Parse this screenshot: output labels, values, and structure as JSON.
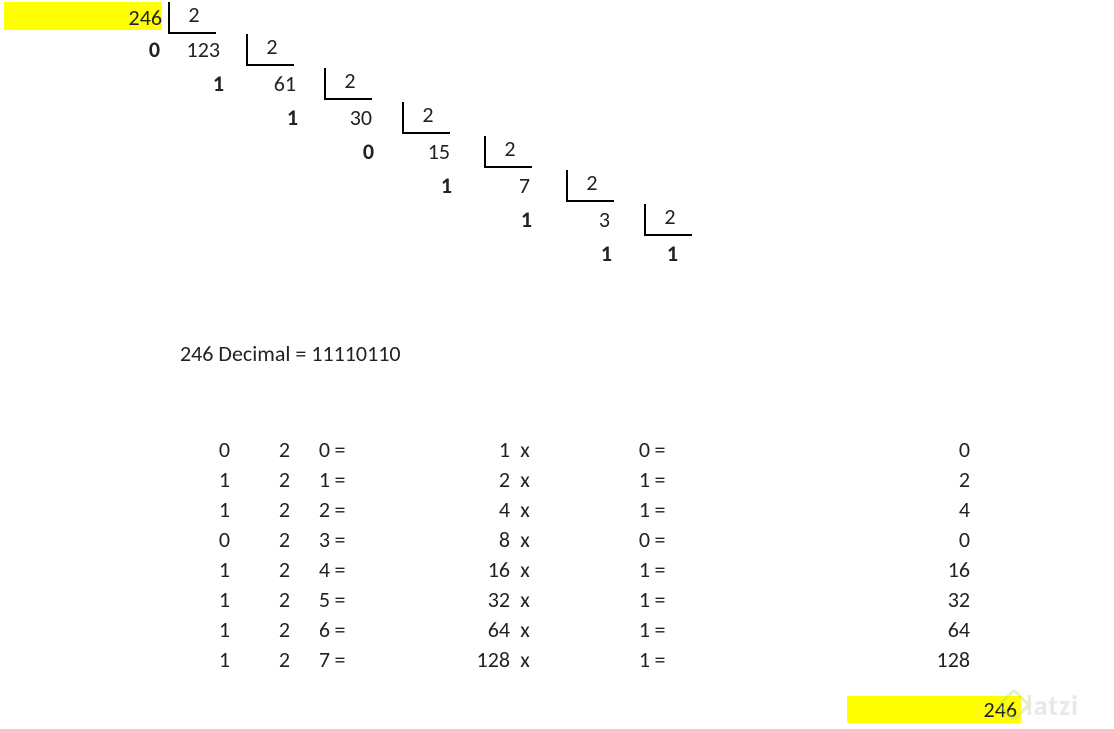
{
  "highlight_color": "#ffff00",
  "division": {
    "start_highlighted": true,
    "dividend": 246,
    "base": 2,
    "steps": [
      {
        "dividend": 246,
        "divisor": 2,
        "remainder": 0,
        "next_quotient": 123
      },
      {
        "dividend": 123,
        "divisor": 2,
        "remainder": 1,
        "next_quotient": 61
      },
      {
        "dividend": 61,
        "divisor": 2,
        "remainder": 1,
        "next_quotient": 30
      },
      {
        "dividend": 30,
        "divisor": 2,
        "remainder": 0,
        "next_quotient": 15
      },
      {
        "dividend": 15,
        "divisor": 2,
        "remainder": 1,
        "next_quotient": 7
      },
      {
        "dividend": 7,
        "divisor": 2,
        "remainder": 1,
        "next_quotient": 3
      },
      {
        "dividend": 3,
        "divisor": 2,
        "remainder": 1,
        "next_quotient": 1
      }
    ],
    "final_quotient": 1
  },
  "equivalence": "246 Decimal = 11110110",
  "verification": {
    "rows": [
      {
        "bit": 0,
        "base": 2,
        "exp": 0,
        "weight": 1,
        "mult": 0,
        "product": 0
      },
      {
        "bit": 1,
        "base": 2,
        "exp": 1,
        "weight": 2,
        "mult": 1,
        "product": 2
      },
      {
        "bit": 1,
        "base": 2,
        "exp": 2,
        "weight": 4,
        "mult": 1,
        "product": 4
      },
      {
        "bit": 0,
        "base": 2,
        "exp": 3,
        "weight": 8,
        "mult": 0,
        "product": 0
      },
      {
        "bit": 1,
        "base": 2,
        "exp": 4,
        "weight": 16,
        "mult": 1,
        "product": 16
      },
      {
        "bit": 1,
        "base": 2,
        "exp": 5,
        "weight": 32,
        "mult": 1,
        "product": 32
      },
      {
        "bit": 1,
        "base": 2,
        "exp": 6,
        "weight": 64,
        "mult": 1,
        "product": 64
      },
      {
        "bit": 1,
        "base": 2,
        "exp": 7,
        "weight": 128,
        "mult": 1,
        "product": 128
      }
    ],
    "sum": 246,
    "sum_highlighted": true
  },
  "watermark_text": "latzi"
}
